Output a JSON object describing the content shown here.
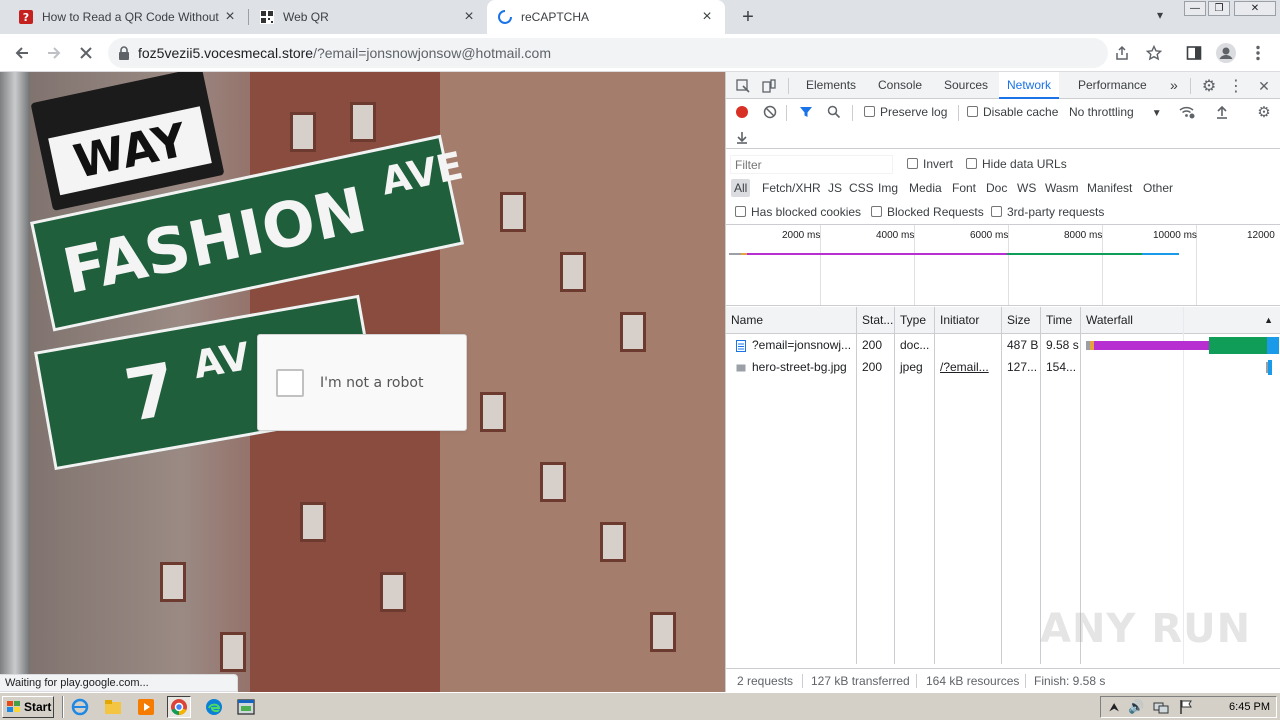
{
  "tabs": [
    {
      "title": "How to Read a QR Code Without a C",
      "icon": "qr-help-icon"
    },
    {
      "title": "Web QR",
      "icon": "qr-code-icon"
    },
    {
      "title": "reCAPTCHA",
      "icon": "loading-spinner-icon",
      "active": true
    }
  ],
  "window_controls": {
    "minimize": "—",
    "restore": "❐",
    "close": "✕"
  },
  "toolbar": {
    "url_host": "foz5vezii5.vocesmecal.store",
    "url_path": "/?email=jonsnowjonsow@hotmail.com"
  },
  "page": {
    "captcha_label": "I'm not a robot",
    "sign_way": "WAY",
    "sign_fashion": "FASHION",
    "sign_ave": "AVE",
    "sign_seven": "7",
    "sign_av": "AV"
  },
  "status_bubble": "Waiting for play.google.com...",
  "devtools": {
    "tabs": [
      "Elements",
      "Console",
      "Sources",
      "Network",
      "Performance"
    ],
    "selected_tab": "Network",
    "more_tabs": "»",
    "preserve_log": "Preserve log",
    "disable_cache": "Disable cache",
    "throttling": "No throttling",
    "filter_placeholder": "Filter",
    "invert": "Invert",
    "hide_data_urls": "Hide data URLs",
    "types": [
      "All",
      "Fetch/XHR",
      "JS",
      "CSS",
      "Img",
      "Media",
      "Font",
      "Doc",
      "WS",
      "Wasm",
      "Manifest",
      "Other"
    ],
    "has_blocked_cookies": "Has blocked cookies",
    "blocked_requests": "Blocked Requests",
    "third_party": "3rd-party requests",
    "timeline_ticks": [
      "2000 ms",
      "4000 ms",
      "6000 ms",
      "8000 ms",
      "10000 ms",
      "12000"
    ],
    "columns": [
      "Name",
      "Stat...",
      "Type",
      "Initiator",
      "Size",
      "Time",
      "Waterfall"
    ],
    "rows": [
      {
        "name": "?email=jonsnowj...",
        "status": "200",
        "type": "doc...",
        "initiator": "",
        "size": "487 B",
        "time": "9.58 s"
      },
      {
        "name": "hero-street-bg.jpg",
        "status": "200",
        "type": "jpeg",
        "initiator": "/?email...",
        "size": "127...",
        "time": "154..."
      }
    ],
    "summary": [
      "2 requests",
      "127 kB transferred",
      "164 kB resources",
      "Finish: 9.58 s"
    ],
    "colors": {
      "accent": "#1a73e8",
      "record": "#d93025",
      "waiting": "#b72fd0",
      "download": "#0f9d58",
      "receive": "#1a9be9"
    }
  },
  "watermark": "ANY RUN",
  "taskbar": {
    "start_label": "Start",
    "clock": "6:45 PM"
  }
}
